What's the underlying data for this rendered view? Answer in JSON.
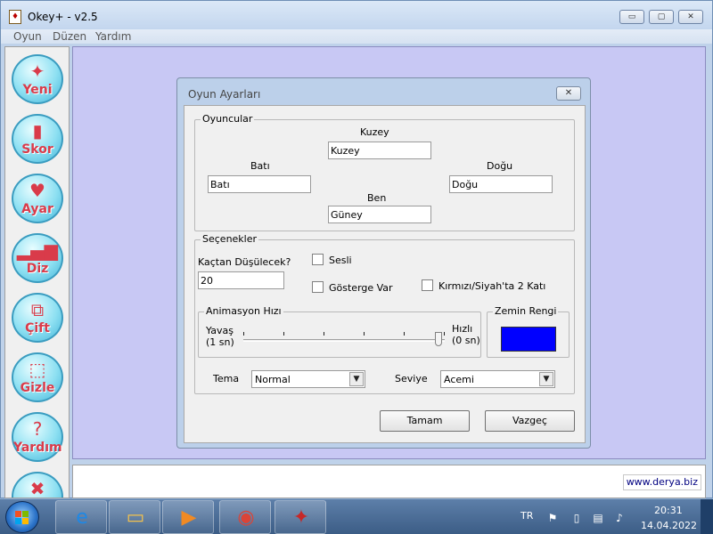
{
  "window": {
    "title": "Okey+ - v2.5",
    "minimize_glyph": "▭",
    "maximize_glyph": "▢",
    "close_glyph": "✕"
  },
  "menu": [
    "Oyun",
    "Düzen",
    "Yardım"
  ],
  "toolbar": [
    {
      "label": "Yeni",
      "icon": "star-icon",
      "glyph": "✦"
    },
    {
      "label": "Skor",
      "icon": "scoreboard-icon",
      "glyph": "▮"
    },
    {
      "label": "Ayar",
      "icon": "heart-icon",
      "glyph": "♥"
    },
    {
      "label": "Diz",
      "icon": "bar-chart-icon",
      "glyph": "▂▄▆"
    },
    {
      "label": "Çift",
      "icon": "pair-icon",
      "glyph": "⧉"
    },
    {
      "label": "Gizle",
      "icon": "hide-icon",
      "glyph": "⬚"
    },
    {
      "label": "Yardım",
      "icon": "question-icon",
      "glyph": "?"
    },
    {
      "label": "",
      "icon": "exit-icon",
      "glyph": "✖"
    }
  ],
  "status_link": "www.derya.biz",
  "dialog": {
    "title": "Oyun Ayarları",
    "close_glyph": "✕",
    "players": {
      "group_label": "Oyuncular",
      "north_label": "Kuzey",
      "north_value": "Kuzey",
      "west_label": "Batı",
      "west_value": "Batı",
      "east_label": "Doğu",
      "east_value": "Doğu",
      "me_label": "Ben",
      "me_value": "Güney"
    },
    "options": {
      "group_label": "Seçenekler",
      "drop_label": "Kaçtan Düşülecek?",
      "drop_value": "20",
      "sound_label": "Sesli",
      "sound_checked": false,
      "indicator_label": "Gösterge Var",
      "indicator_checked": false,
      "double_label": "Kırmızı/Siyah'ta 2 Katı",
      "double_checked": false,
      "animation": {
        "group_label": "Animasyon Hızı",
        "slow_label": "Yavaş",
        "slow_sub": "(1 sn)",
        "fast_label": "Hızlı",
        "fast_sub": "(0 sn)",
        "value_fraction": 0.97
      },
      "bg_color": {
        "group_label": "Zemin Rengi",
        "color": "#0000ff"
      },
      "theme_label": "Tema",
      "theme_value": "Normal",
      "level_label": "Seviye",
      "level_value": "Acemi",
      "combo_arrow": "▼"
    },
    "ok_label": "Tamam",
    "cancel_label": "Vazgeç"
  },
  "taskbar": {
    "items": [
      {
        "name": "internet-explorer",
        "glyph": "e",
        "color": "#1e88e5"
      },
      {
        "name": "file-explorer",
        "glyph": "▭",
        "color": "#f2c14e"
      },
      {
        "name": "media-player",
        "glyph": "▶",
        "color": "#f08a24"
      },
      {
        "name": "chrome",
        "glyph": "◉",
        "color": "#db4437"
      },
      {
        "name": "okey-app",
        "glyph": "✦",
        "color": "#c62828"
      }
    ],
    "language": "TR",
    "time": "20:31",
    "date": "14.04.2022"
  }
}
